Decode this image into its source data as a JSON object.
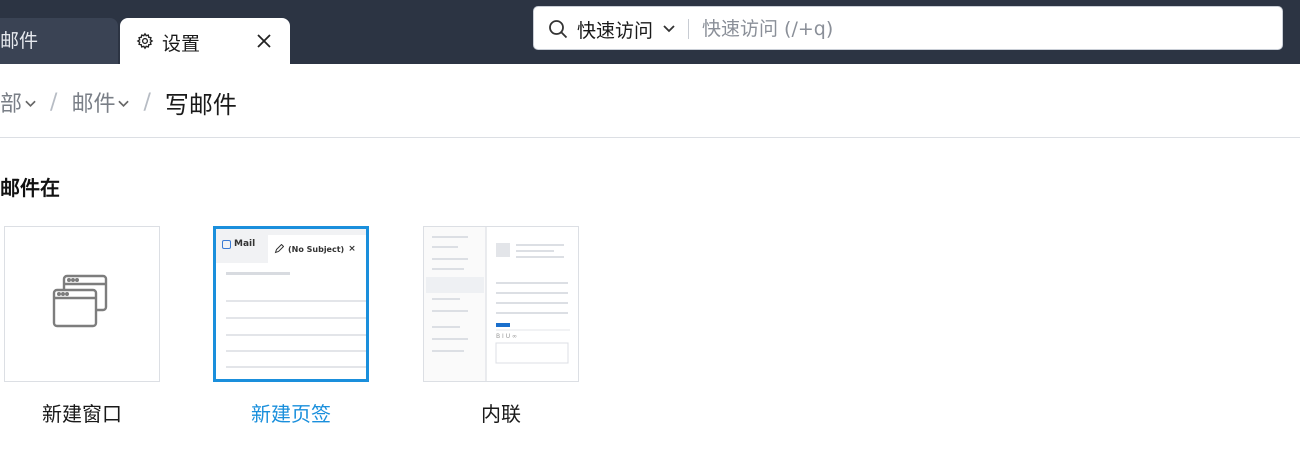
{
  "tabs": {
    "inactive_label": "邮件",
    "active_label": "设置"
  },
  "search": {
    "scope_label": "快速访问",
    "placeholder": "快速访问 (/+q)"
  },
  "breadcrumb": {
    "items": [
      "部",
      "邮件"
    ],
    "current": "写邮件"
  },
  "section": {
    "title": "邮件在"
  },
  "options": [
    {
      "label": "新建窗口",
      "selected": false
    },
    {
      "label": "新建页签",
      "selected": true
    },
    {
      "label": "内联",
      "selected": false
    }
  ],
  "preview": {
    "mail_tab": "Mail",
    "subject_tab": "(No Subject)",
    "close_glyph": "×",
    "format_toolbar": "B I U ∞"
  },
  "colors": {
    "topbar": "#2c3443",
    "accent": "#1a8fdc"
  },
  "icons": [
    "gear-icon",
    "close-icon",
    "search-icon",
    "chevron-down-icon",
    "new-window-icon",
    "pencil-icon"
  ]
}
